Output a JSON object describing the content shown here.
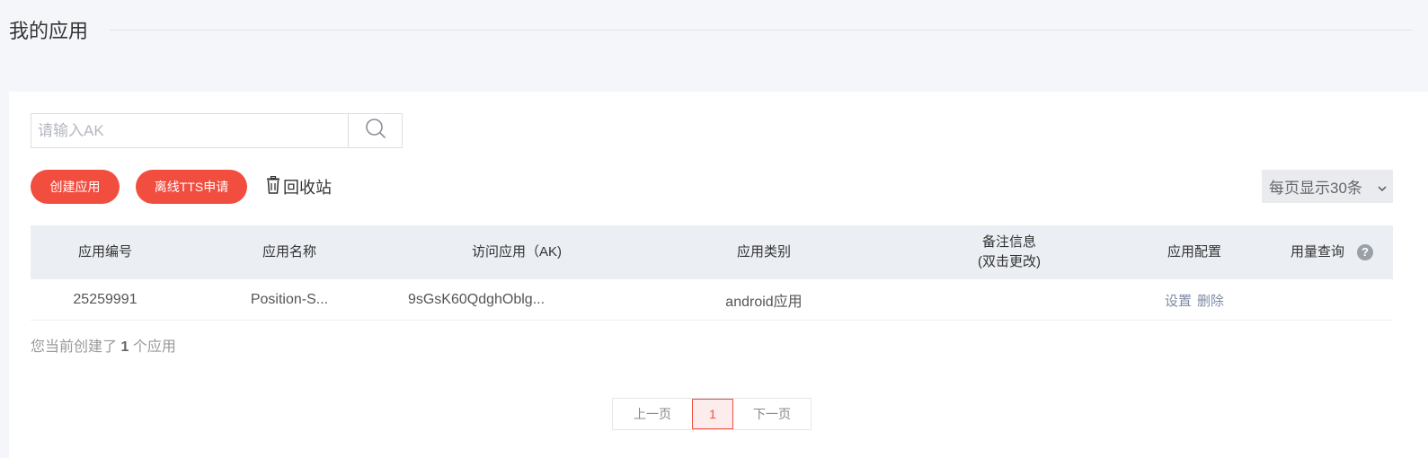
{
  "page": {
    "title": "我的应用"
  },
  "search": {
    "placeholder": "请输入AK",
    "value": ""
  },
  "toolbar": {
    "create_label": "创建应用",
    "tts_label": "离线TTS申请",
    "recycle_label": "回收站",
    "page_size_label": "每页显示30条"
  },
  "table": {
    "headers": [
      "应用编号",
      "应用名称",
      "访问应用（AK)",
      "应用类别",
      "备注信息",
      "(双击更改)",
      "应用配置",
      "用量查询"
    ],
    "rows": [
      {
        "id": "25259991",
        "name": "Position-S...",
        "ak": "9sGsK60QdghOblg...",
        "category": "android应用",
        "note": "",
        "settings": "设置",
        "delete": "删除"
      }
    ]
  },
  "summary": {
    "prefix": "您当前创建了",
    "count": "1",
    "suffix": "个应用"
  },
  "pagination": {
    "prev": "上一页",
    "current": "1",
    "next": "下一页"
  },
  "icons": {
    "search": "search-icon",
    "trash": "trash-icon",
    "chevron": "chevron-down-icon",
    "help": "help-icon"
  },
  "colors": {
    "accent": "#f24e40",
    "header_bg": "#ebeef3",
    "link": "#7e8ba3"
  }
}
